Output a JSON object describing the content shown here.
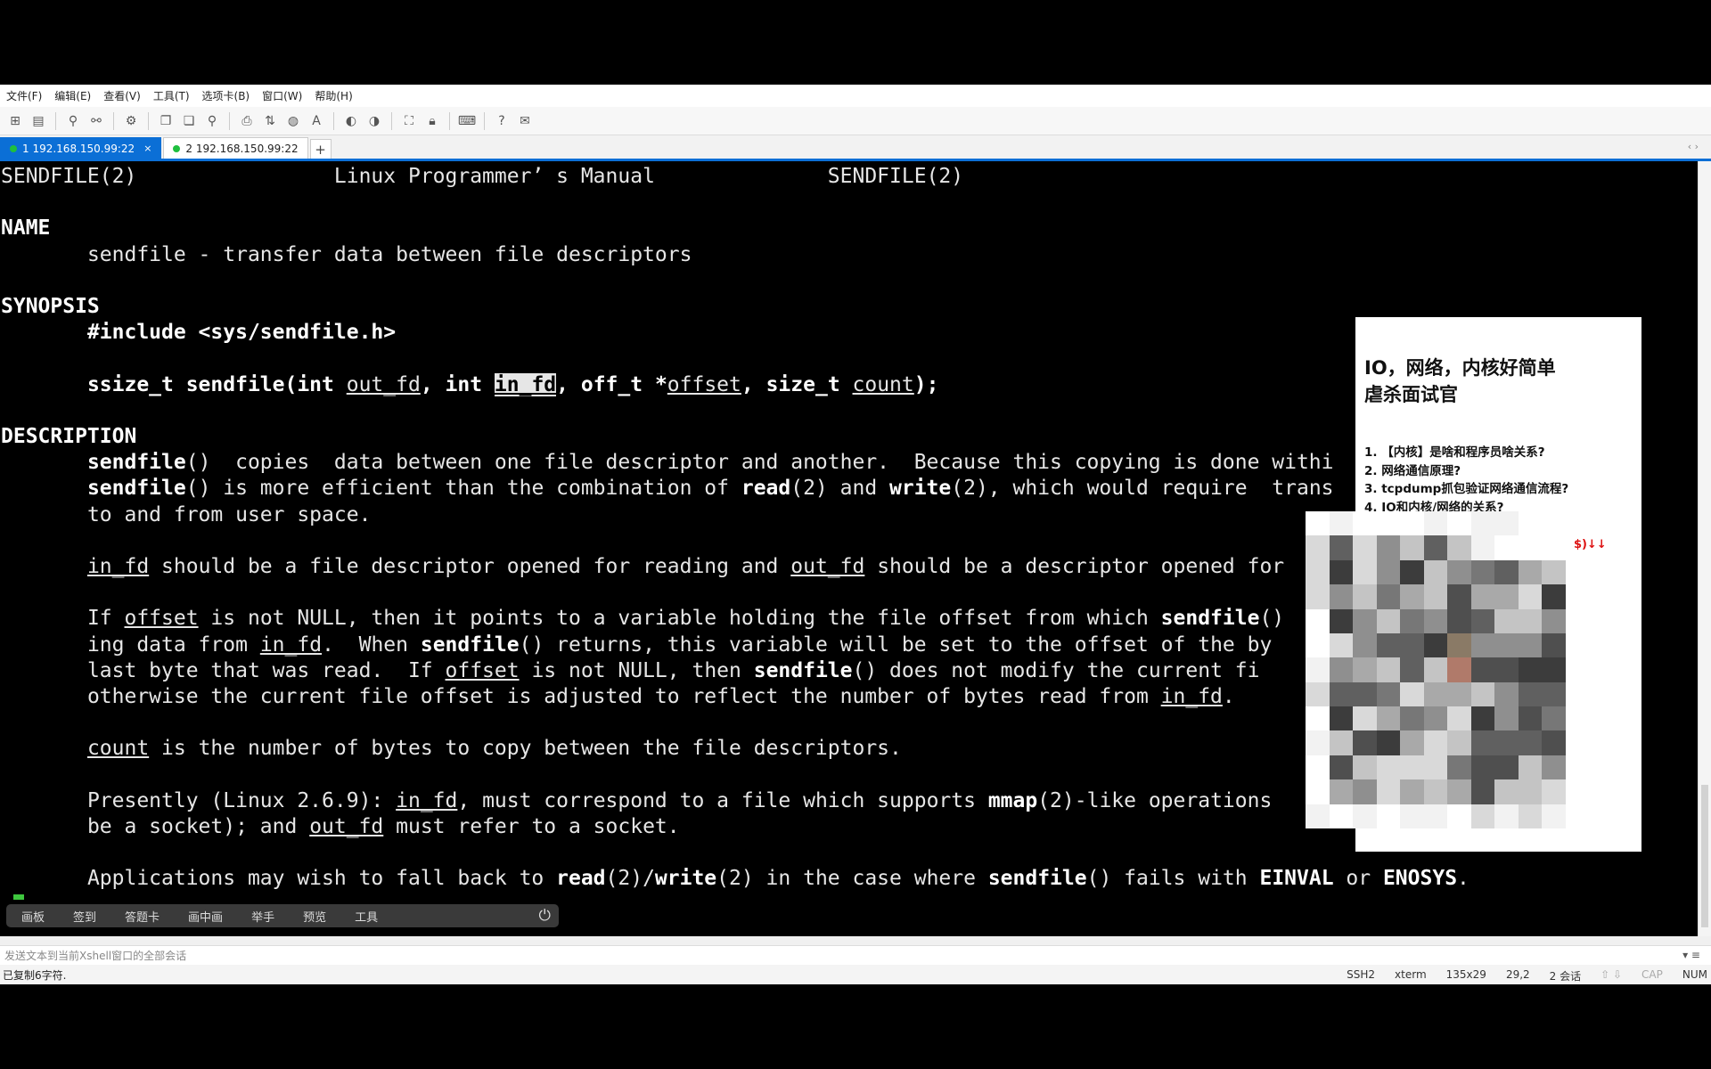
{
  "menu": [
    "文件(F)",
    "编辑(E)",
    "查看(V)",
    "工具(T)",
    "选项卡(B)",
    "窗口(W)",
    "帮助(H)"
  ],
  "tabs": [
    {
      "label": "1 192.168.150.99:22",
      "close": "×"
    },
    {
      "label": "2 192.168.150.99:22"
    }
  ],
  "tab_add": "+",
  "tab_nav": "‹ ›",
  "terminal": {
    "header": {
      "left": "SENDFILE(2)",
      "center": "Linux Programmer’ s Manual",
      "right": "SENDFILE(2)"
    },
    "sections": {
      "name": "NAME",
      "synopsis": "SYNOPSIS",
      "description": "DESCRIPTION"
    },
    "name_line": "sendfile - transfer data between file descriptors",
    "include": "#include <sys/sendfile.h>",
    "signature": {
      "ret": "ssize_t sendfile(int ",
      "p1": "out_fd",
      "sep1": ", int ",
      "p2": "in_fd",
      "sep2": ", off_t *",
      "p3": "offset",
      "sep3": ", size_t ",
      "p4": "count",
      "end": ");"
    },
    "desc": {
      "l1a": "sendfile",
      "l1b": "()  copies  data between one file descriptor and another.  Because this copying is done withi",
      "l2a": "sendfile",
      "l2b": "() is more efficient than the combination of ",
      "l2c": "read",
      "l2d": "(2) and ",
      "l2e": "write",
      "l2f": "(2), which would require  trans",
      "l3": "to and from user space.",
      "p2a": "in_fd",
      "p2b": " should be a file descriptor opened for reading and ",
      "p2c": "out_fd",
      "p2d": " should be a descriptor opened for",
      "p3a": "If ",
      "p3b": "offset",
      "p3c": " is not NULL, then it points to a variable holding the file offset from which ",
      "p3d": "sendfile",
      "p3e": "()",
      "p3f": "ing data from ",
      "p3g": "in_fd",
      "p3h": ".  When ",
      "p3i": "sendfile",
      "p3j": "() returns, this variable will be set to the offset of the by",
      "p3k": "last byte that was read.  If ",
      "p3l": "offset",
      "p3m": " is not NULL, then ",
      "p3n": "sendfile",
      "p3o": "() does not modify the current fi",
      "p3p": "otherwise the current file offset is adjusted to reflect the number of bytes read from ",
      "p3q": "in_fd",
      "p3r": ".",
      "p4a": "count",
      "p4b": " is the number of bytes to copy between the file descriptors.",
      "p5a": "Presently (Linux 2.6.9): ",
      "p5b": "in_fd",
      "p5c": ", must correspond to a file which supports ",
      "p5d": "mmap",
      "p5e": "(2)-like operations",
      "p5f": "be a socket); and ",
      "p5g": "out_fd",
      "p5h": " must refer to a socket.",
      "p6a": "Applications may wish to fall back to ",
      "p6b": "read",
      "p6c": "(2)/",
      "p6d": "write",
      "p6e": "(2) in the case where ",
      "p6f": "sendfile",
      "p6g": "() fails with ",
      "p6h": "EINVAL",
      "p6i": " or ",
      "p6j": "ENOSYS",
      "p6k": "."
    }
  },
  "popup": {
    "title_line1": "IO，网络，内核好简单",
    "title_line2": "虐杀面试官",
    "items": [
      "1. 【内核】是啥和程序员啥关系?",
      "2. 网络通信原理?",
      "3. tcpdump抓包验证网络通信流程?",
      "4. IO和内核/网络的关系?"
    ],
    "red_note": "$)↓↓"
  },
  "meeting_bar": {
    "items": [
      "画板",
      "签到",
      "答题卡",
      "画中画",
      "举手",
      "预览",
      "工具"
    ],
    "power": "⏻"
  },
  "compose": {
    "placeholder": "发送文本到当前Xshell窗口的全部会话",
    "ctrl": "▾  ≡"
  },
  "status": {
    "left": "已复制6字符.",
    "protocol": "SSH2",
    "term": "xterm",
    "size": "135x29",
    "pos": "29,2",
    "sessions": "2 会话",
    "arrows": "⇧ ⇩",
    "cap": "CAP",
    "num": "NUM"
  }
}
